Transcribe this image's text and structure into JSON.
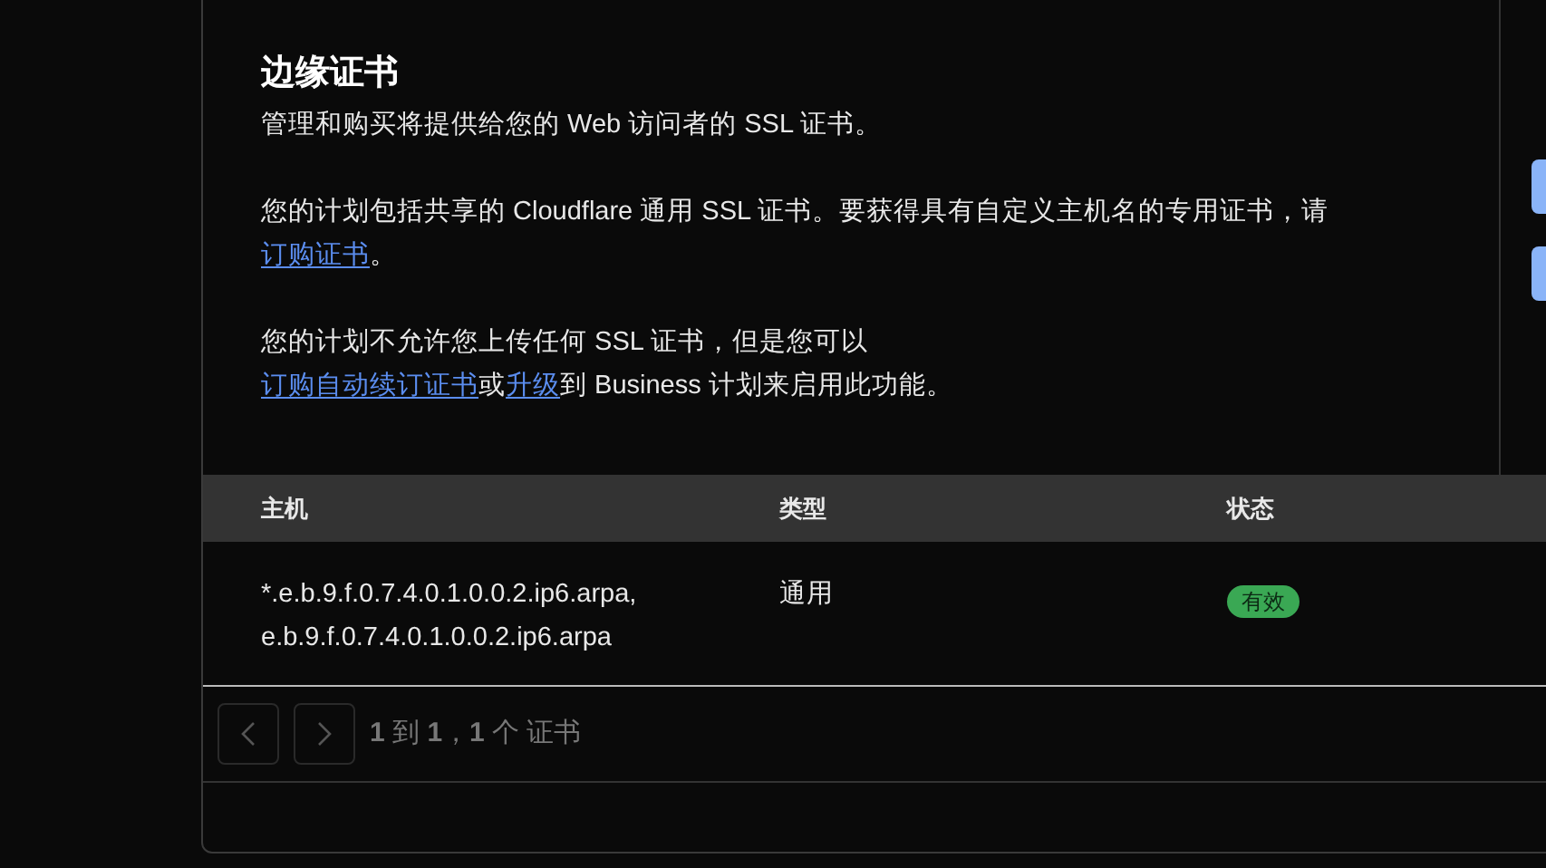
{
  "section": {
    "title": "边缘证书",
    "description": "管理和购买将提供给您的 Web 访问者的 SSL 证书。",
    "paragraphs": [
      [
        {
          "kind": "text",
          "text": "您的计划包括共享的 Cloudflare 通用 SSL 证书。要获得具有自定义主机名的专用证书，请"
        },
        {
          "kind": "link",
          "text": "订购证书"
        },
        {
          "kind": "text",
          "text": "。"
        }
      ],
      [
        {
          "kind": "text",
          "text": "您的计划不允许您上传任何 SSL 证书，但是您可以"
        },
        {
          "kind": "break"
        },
        {
          "kind": "link",
          "text": "订购自动续订证书"
        },
        {
          "kind": "text",
          "text": "或"
        },
        {
          "kind": "link",
          "text": "升级"
        },
        {
          "kind": "text",
          "text": "到 Business 计划来启用此功能。"
        }
      ]
    ]
  },
  "table": {
    "columns": [
      "主机",
      "类型",
      "状态"
    ],
    "rows": [
      {
        "hosts": [
          "*.e.b.9.f.0.7.4.0.1.0.0.2.ip6.arpa,",
          "e.b.9.f.0.7.4.0.1.0.0.2.ip6.arpa"
        ],
        "type": "通用",
        "status": "有效",
        "color": "#3aa854"
      }
    ]
  },
  "pagination": {
    "prev_disabled": true,
    "next_disabled": true,
    "summary": "**1** 到 **1**，**1** 个 证书"
  }
}
